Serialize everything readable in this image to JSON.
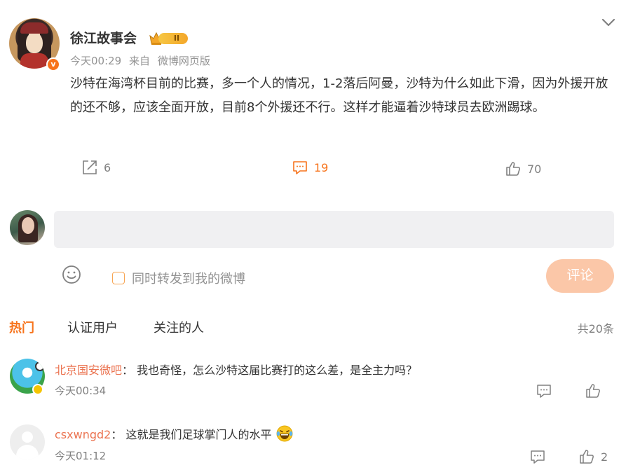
{
  "post": {
    "author": "徐江故事会",
    "vip_level": "II",
    "time": "今天00:29",
    "source_prefix": "来自",
    "source": "微博网页版",
    "text": "沙特在海湾杯目前的比赛，多一个人的情况，1-2落后阿曼，沙特为什么如此下滑，因为外援开放的还不够，应该全面开放，目前8个外援还不行。这样才能逼着沙特球员去欧洲踢球。",
    "repost_count": "6",
    "comment_count": "19",
    "like_count": "70"
  },
  "composer": {
    "placeholder": "",
    "repost_label": "同时转发到我的微博",
    "submit_label": "评论"
  },
  "tabs": [
    {
      "label": "热门",
      "active": true
    },
    {
      "label": "认证用户",
      "active": false
    },
    {
      "label": "关注的人",
      "active": false
    }
  ],
  "total": "共20条",
  "comments": [
    {
      "user": "北京国安微吧",
      "separator": "：",
      "text": "我也奇怪，怎么沙特这届比赛打的这么差，是全主力吗？",
      "time": "今天00:34",
      "likes": ""
    },
    {
      "user": "csxwngd2",
      "separator": "：",
      "text": "这就是我们足球掌门人的水平",
      "emoji": "laughing-tears-emoji",
      "time": "今天01:12",
      "likes": "2"
    }
  ],
  "colors": {
    "accent": "#f7731b",
    "username": "#eb7350",
    "submit_disabled": "#fbc7a8",
    "input_bg": "#f0f0f2",
    "muted": "#939393"
  }
}
